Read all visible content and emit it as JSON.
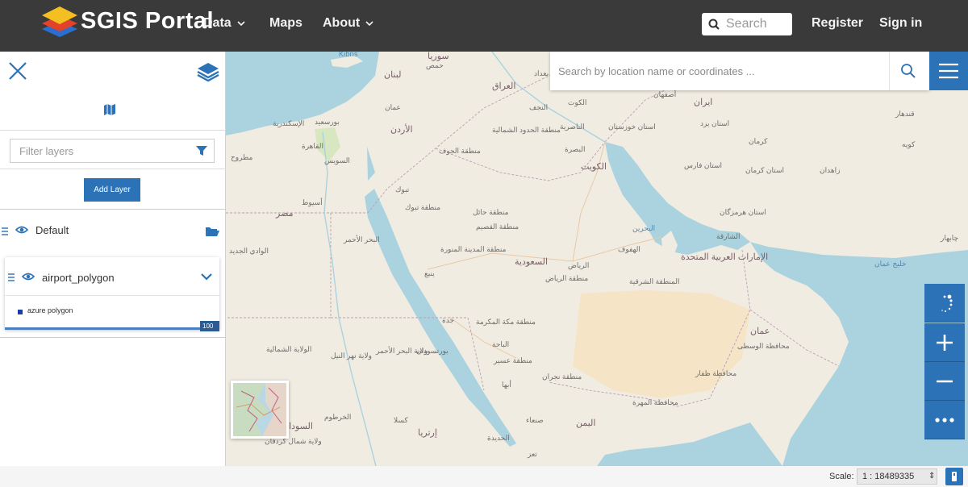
{
  "navbar": {
    "brand": "SGIS Portal",
    "menu": [
      {
        "label": "Data"
      },
      {
        "label": "Maps"
      },
      {
        "label": "About"
      }
    ],
    "search_placeholder": "Search",
    "register": "Register",
    "sign_in": "Sign in",
    "bg_color": "#3a3a3a"
  },
  "panel": {
    "filter_placeholder": "Filter layers",
    "add_layer_label": "Add Layer",
    "group": {
      "label": "Default"
    },
    "layer": {
      "name": "airport_polygon",
      "legend_label": "azure polygon",
      "opacity_label": "100 %",
      "opacity": 1.0
    }
  },
  "map": {
    "location_search_placeholder": "Search by location name or coordinates ...",
    "accent_color": "#2c72b7",
    "labels": [
      "Kıbrıs",
      "سوريا",
      "حمص",
      "لبنان",
      "العراق",
      "بغداد",
      "الكوت",
      "أصفهان",
      "ایران",
      "الإسكندرية",
      "بورسعيد",
      "عمان",
      "الأردن",
      "النجف",
      "استان يزد",
      "قندهار",
      "القاهرة",
      "مطروح",
      "السويس",
      "الناصرية",
      "استان خوزستان",
      "منطقة الحدود الشمالية",
      "منطقة الجوف",
      "البصرة",
      "كرمان",
      "الكويت",
      "استان فارس",
      "استان كرمان",
      "زاهدان",
      "تبوك",
      "أسيوط",
      "مصر",
      "منطقة تبوك",
      "منطقة حائل",
      "استان هرمزگان",
      "منطقة القصيم",
      "البحرين",
      "الشارقة",
      "البحر الأحمر",
      "الوادي الجديد",
      "منطقة المدينة المنورة",
      "السعودية",
      "الرياض",
      "الهفوف",
      "الإمارات العربية المتحدة",
      "ينبع",
      "منطقة الرياض",
      "المنطقة الشرقية",
      "جدة",
      "منطقة مكة المكرمة",
      "بورتسودان",
      "الباحة",
      "منطقة عسير",
      "عمان",
      "محافظة الوسطى",
      "الولاية الشمالية",
      "ولاية نهر النيل",
      "ولاية البحر الأحمر",
      "أبها",
      "منطقة نجران",
      "محافظة ظفار",
      "الخرطوم",
      "كسلا",
      "صنعاء",
      "اليمن",
      "محافظة المهرة",
      "السودان",
      "ولاية شمال كردفان",
      "إرتريا",
      "الحديدة",
      "تعز",
      "كويه",
      "خليج عمان",
      "چابهار"
    ]
  },
  "statusbar": {
    "scale_label": "Scale:",
    "scale_value": "1 : 18489335"
  },
  "icons": {
    "logo": "sgis-logo-icon",
    "search": "search-icon",
    "close": "close-icon",
    "layers": "layers-icon",
    "map": "map-icon",
    "filter": "filter-icon",
    "eye": "eye-icon",
    "folder": "folder-open-icon",
    "chevron": "chevron-down-icon",
    "menu": "hamburger-menu-icon",
    "locate": "locate-icon",
    "zoom_in": "plus-icon",
    "zoom_out": "minus-icon",
    "more": "more-icon"
  }
}
